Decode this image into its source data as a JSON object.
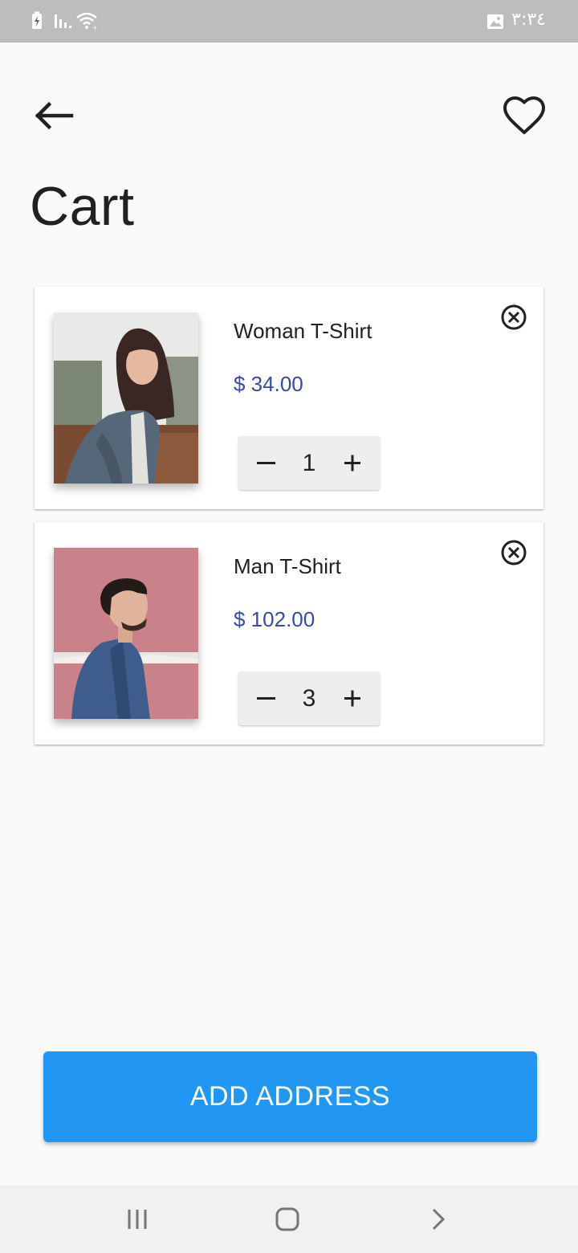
{
  "status_bar": {
    "time": "٣:٣٤",
    "icons": [
      "battery-charging-icon",
      "signal-icon",
      "wifi-icon",
      "gallery-notification-icon"
    ]
  },
  "header": {
    "back_icon": "arrow-left-icon",
    "favorite_icon": "heart-outline-icon",
    "title": "Cart"
  },
  "cart": {
    "items": [
      {
        "name": "Woman T-Shirt",
        "price": "$ 34.00",
        "quantity": "1",
        "image": "woman-denim-jacket-photo"
      },
      {
        "name": "Man T-Shirt",
        "price": "$ 102.00",
        "quantity": "3",
        "image": "man-denim-shirt-photo"
      }
    ]
  },
  "actions": {
    "add_address_label": "ADD ADDRESS"
  },
  "nav_bar": {
    "icons": [
      "recents-icon",
      "home-icon",
      "back-chevron-icon"
    ]
  },
  "colors": {
    "accent": "#2196f3",
    "price": "#3949ab",
    "status_bar": "#bdbdbd"
  }
}
